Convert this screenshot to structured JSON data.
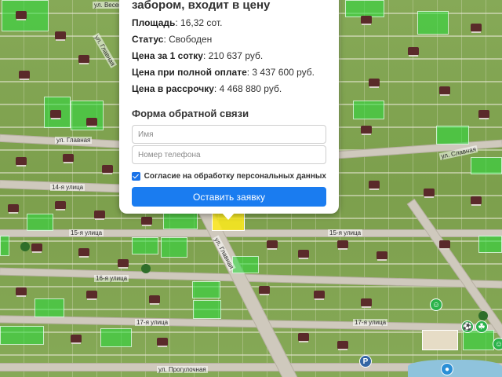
{
  "plot_popup": {
    "title": "забором, входит в цену",
    "area_label": "Площадь",
    "area_value": ": 16,32 сот.",
    "status_label": "Статус",
    "status_value": ": Свободен",
    "price_per_sotka_label": "Цена за 1 сотку",
    "price_per_sotka_value": ": 210 637 руб.",
    "full_price_label": "Цена при полной оплате",
    "full_price_value": ": 3 437 600 руб.",
    "installment_label": "Цена в рассрочку",
    "installment_value": ": 4 468 880 руб."
  },
  "form": {
    "title": "Форма обратной связи",
    "name_placeholder": "Имя",
    "phone_placeholder": "Номер телефона",
    "consent_label": "Согласие на обработку персональных данных",
    "consent_checked": true,
    "submit_label": "Оставить заявку"
  },
  "map": {
    "street_labels": [
      "ул. Весенняя",
      "ул. Главная",
      "14-я улица",
      "15-я улица",
      "15-я улица",
      "16-я улица",
      "17-я улица",
      "17-я улица",
      "ул. Прогулочная",
      "ул. Главная",
      "ул. Главная",
      "ул. Славная"
    ],
    "colors": {
      "highlight": "#28dc3c",
      "selected": "#ffeb1e",
      "button": "#1a7cf0"
    }
  }
}
